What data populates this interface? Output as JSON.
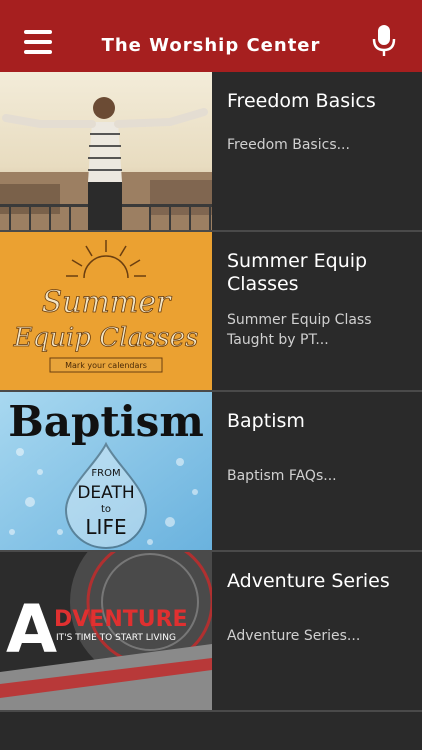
{
  "header": {
    "title": "The Worship Center",
    "menu_icon": "hamburger-menu-icon",
    "mic_icon": "microphone-icon"
  },
  "items": [
    {
      "title": "Freedom Basics",
      "subtitle": "Freedom Basics...",
      "thumb": "freedom-basics-thumbnail"
    },
    {
      "title": "Summer Equip Classes",
      "subtitle": "Summer Equip Class Taught by PT...",
      "thumb": "summer-equip-thumbnail",
      "thumb_text": {
        "line1": "Summer",
        "line2": "Equip Classes",
        "tag": "Mark your calendars"
      }
    },
    {
      "title": "Baptism",
      "subtitle": "Baptism FAQs...",
      "thumb": "baptism-thumbnail",
      "thumb_text": {
        "headline": "Baptism",
        "from": "FROM",
        "death": "DEATH",
        "to": "to",
        "life": "LIFE"
      }
    },
    {
      "title": "Adventure Series",
      "subtitle": "Adventure Series...",
      "thumb": "adventure-thumbnail",
      "thumb_text": {
        "a": "A",
        "rest": "DVENTURE",
        "tagline": "IT'S TIME TO START LIVING"
      }
    }
  ],
  "colors": {
    "header": "#a61f1f",
    "background": "#2a2a2a",
    "divider": "#4a4a4a"
  }
}
